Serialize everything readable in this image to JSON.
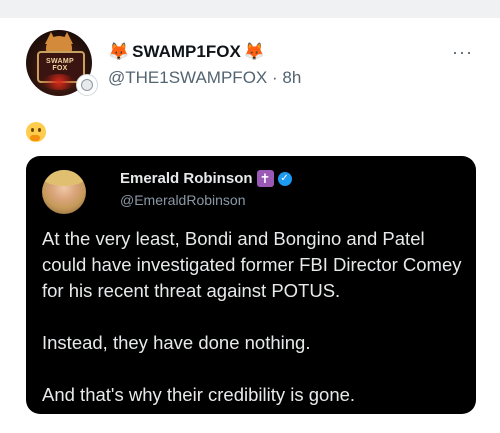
{
  "post": {
    "display_name": "SWAMP1FOX",
    "name_emoji": "🦊",
    "handle": "@THE1SWAMPFOX",
    "separator": "·",
    "time": "8h",
    "more_label": "···",
    "avatar_text": "SWAMP FOX",
    "body_emoji": "thinking-face-emoji",
    "icons": {
      "avatar": "fox-avatar",
      "org_badge": "affiliate-badge-icon",
      "more": "more-options-icon"
    }
  },
  "quote": {
    "display_name": "Emerald Robinson",
    "cross_badge": "✝",
    "verified_mark": "✓",
    "handle": "@EmeraldRobinson",
    "paragraphs": [
      "At the very least, Bondi and Bongino and Patel could have investigated former FBI Director Comey for his recent threat against POTUS.",
      "Instead, they have done nothing.",
      "And that's why their credibility is gone."
    ],
    "colors": {
      "card_bg": "#000000",
      "text": "#e7e9ea",
      "muted": "#8b98a5",
      "verified": "#1d9bf0",
      "cross_badge": "#9b59b6"
    }
  },
  "colors": {
    "page_bg": "#ffffff",
    "top_band": "#eff1f3",
    "muted": "#536471",
    "fox": "#f26b1d"
  }
}
